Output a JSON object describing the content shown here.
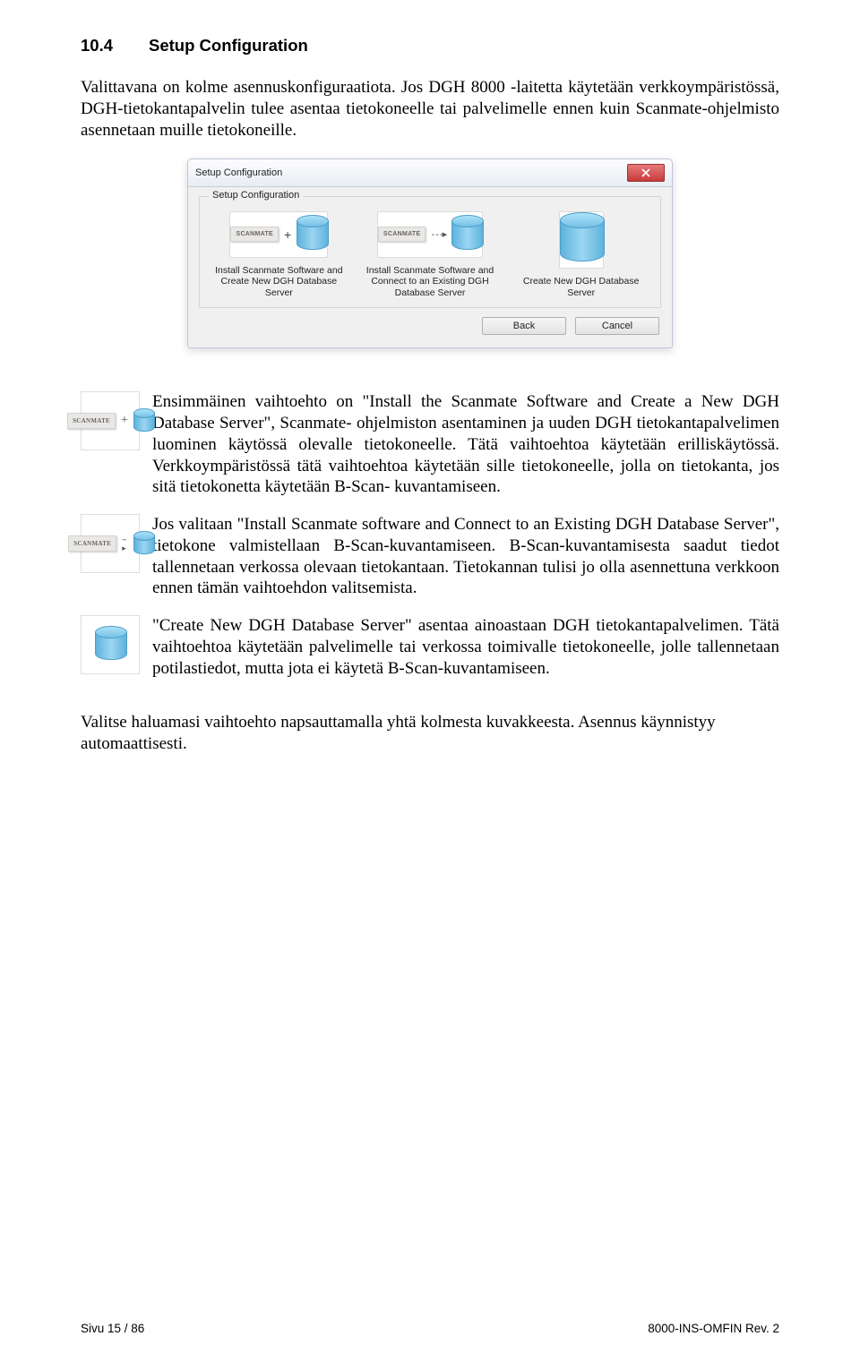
{
  "section": {
    "number": "10.4",
    "title": "Setup Configuration"
  },
  "intro": "Valittavana on kolme asennuskonfiguraatiota. Jos DGH 8000 -laitetta käytetään verkkoympäristössä, DGH-tietokantapalvelin tulee asentaa tietokoneelle tai palvelimelle ennen kuin Scanmate-ohjelmisto asennetaan muille tietokoneille.",
  "dialog": {
    "title": "Setup Configuration",
    "group_title": "Setup Configuration",
    "options": [
      "Install Scanmate Software and Create New DGH Database Server",
      "Install Scanmate Software and Connect to an Existing DGH Database Server",
      "Create New DGH Database Server"
    ],
    "back": "Back",
    "cancel": "Cancel",
    "badge": "SCANMATE"
  },
  "descriptions": [
    "Ensimmäinen vaihtoehto on \"Install the Scanmate Software and Create a New DGH Database Server\", Scanmate- ohjelmiston asentaminen ja uuden DGH tietokantapalvelimen luominen käytössä olevalle tietokoneelle. Tätä vaihtoehtoa käytetään erilliskäytössä. Verkkoympäristössä tätä vaihtoehtoa käytetään sille tietokoneelle, jolla on tietokanta, jos sitä tietokonetta käytetään B-Scan- kuvantamiseen.",
    "Jos valitaan \"Install Scanmate software and Connect to an Existing DGH Database Server\", tietokone valmistellaan B-Scan-kuvantamiseen. B-Scan-kuvantamisesta saadut tiedot tallennetaan verkossa olevaan tietokantaan. Tietokannan tulisi jo olla asennettuna verkkoon ennen tämän vaihtoehdon valitsemista.",
    "\"Create New DGH Database Server\" asentaa ainoastaan DGH tietokantapalvelimen. Tätä vaihtoehtoa käytetään palvelimelle tai verkossa toimivalle tietokoneelle, jolle tallennetaan potilastiedot, mutta jota ei käytetä B-Scan-kuvantamiseen."
  ],
  "closing": "Valitse haluamasi vaihtoehto napsauttamalla yhtä kolmesta kuvakkeesta. Asennus käynnistyy automaattisesti.",
  "footer": {
    "left": "Sivu 15 / 86",
    "right": "8000-INS-OMFIN Rev. 2"
  }
}
